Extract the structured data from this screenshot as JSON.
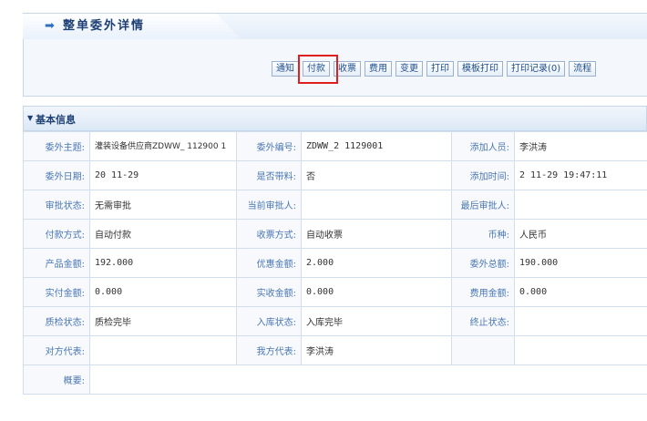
{
  "page": {
    "title": "整单委外详情",
    "arrow_icon": "arrow-right-icon"
  },
  "toolbar": {
    "buttons": [
      "通知",
      "付款",
      "收票",
      "费用",
      "变更",
      "打印",
      "模板打印",
      "打印记录(0)",
      "流程"
    ],
    "highlighted": "付款",
    "highlight_color": "#e02020"
  },
  "section": {
    "title": "基本信息"
  },
  "fields": {
    "subject_label": "委外主题:",
    "subject_value": "灌装设备供应商ZDWW_   112900 1",
    "code_label": "委外编号:",
    "code_value": "ZDWW_2  1129001",
    "adder_label": "添加人员:",
    "adder_value": "李洪涛",
    "date_label": "委外日期:",
    "date_value": "20   11-29",
    "material_label": "是否带料:",
    "material_value": "否",
    "addtime_label": "添加时间:",
    "addtime_value": "2    11-29 19:47:11",
    "approval_label": "审批状态:",
    "approval_value": "无需审批",
    "cur_approver_label": "当前审批人:",
    "cur_approver_value": "",
    "last_approver_label": "最后审批人:",
    "last_approver_value": "",
    "pay_method_label": "付款方式:",
    "pay_method_value": "自动付款",
    "receipt_method_label": "收票方式:",
    "receipt_method_value": "自动收票",
    "currency_label": "币种:",
    "currency_value": "人民币",
    "product_amount_label": "产品金额:",
    "product_amount_value": "192.000",
    "discount_label": "优惠金额:",
    "discount_value": "2.000",
    "total_label": "委外总额:",
    "total_value": "190.000",
    "paid_label": "实付金额:",
    "paid_value": "0.000",
    "received_label": "实收金额:",
    "received_value": "0.000",
    "fee_label": "费用金额:",
    "fee_value": "0.000",
    "qc_label": "质检状态:",
    "qc_value": "质检完毕",
    "stock_label": "入库状态:",
    "stock_value": "入库完毕",
    "end_label": "终止状态:",
    "end_value": "",
    "their_rep_label": "对方代表:",
    "their_rep_value": "",
    "our_rep_label": "我方代表:",
    "our_rep_value": "李洪涛",
    "summary_label": "概要:",
    "summary_value": ""
  }
}
